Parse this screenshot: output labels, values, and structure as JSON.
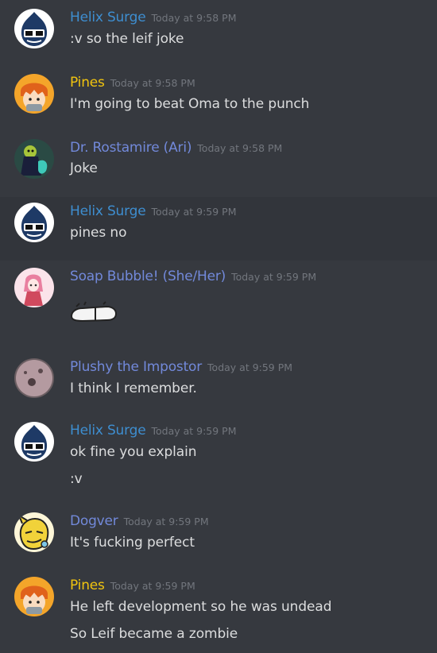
{
  "colors": {
    "background": "#36393f",
    "hover_background": "#32353b",
    "timestamp": "#72767d",
    "message_text": "#dcddde",
    "helix": "#3e8ed0",
    "pines": "#f1c40f",
    "blurple": "#7289da"
  },
  "messages": [
    {
      "author": "Helix Surge",
      "time": "Today at 9:58 PM",
      "lines": [
        ":v so the leif joke"
      ],
      "avatar": "helix-avatar"
    },
    {
      "author": "Pines",
      "time": "Today at 9:58 PM",
      "lines": [
        "I'm going to beat Oma to the punch"
      ],
      "avatar": "pines-avatar"
    },
    {
      "author": "Dr. Rostamire (Ari)",
      "time": "Today at 9:58 PM",
      "lines": [
        "Joke"
      ],
      "avatar": "rostamire-avatar"
    },
    {
      "author": "Helix Surge",
      "time": "Today at 9:59 PM",
      "lines": [
        "pines no"
      ],
      "avatar": "helix-avatar"
    },
    {
      "author": "Soap Bubble! (She/Her)",
      "time": "Today at 9:59 PM",
      "lines": [],
      "avatar": "soap-bubble-avatar",
      "attachment": "pill-sticker-image"
    },
    {
      "author": "Plushy the Impostor",
      "time": "Today at 9:59 PM",
      "lines": [
        "I think I remember."
      ],
      "avatar": "plushy-avatar"
    },
    {
      "author": "Helix Surge",
      "time": "Today at 9:59 PM",
      "lines": [
        "ok fine you explain",
        ":v"
      ],
      "avatar": "helix-avatar"
    },
    {
      "author": "Dogver",
      "time": "Today at 9:59 PM",
      "lines": [
        "It's fucking perfect"
      ],
      "avatar": "dogver-avatar"
    },
    {
      "author": "Pines",
      "time": "Today at 9:59 PM",
      "lines": [
        "He left development so he was undead",
        "So Leif became a zombie"
      ],
      "avatar": "pines-avatar"
    }
  ]
}
